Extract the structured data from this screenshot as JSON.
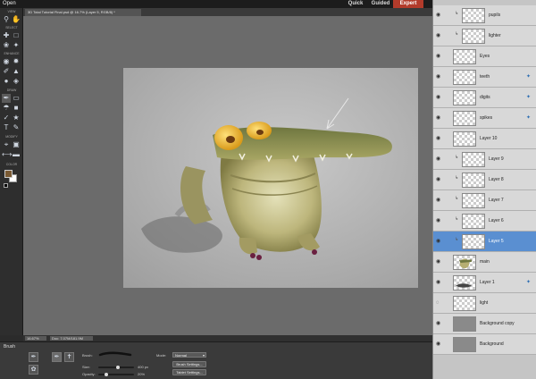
{
  "app": {
    "open_label": "Open",
    "tabs": {
      "quick": "Quick",
      "guided": "Guided",
      "expert": "Expert"
    },
    "accent_color": "#b23b2b"
  },
  "document": {
    "tab_title": "3D Total Tutorial Final.psd @ 16.7% (Layer 5, RGB/8) *",
    "zoom": "16.67%",
    "info": "Doc: 7.07M/181.9M"
  },
  "toolbox": {
    "sections": {
      "view": "VIEW",
      "select": "SELECT",
      "enhance": "ENHANCE",
      "draw": "DRAW",
      "modify": "MODIFY",
      "color": "COLOR"
    },
    "foreground_color": "#7a5a33",
    "background_color": "#ffffff"
  },
  "options": {
    "title": "Brush",
    "brush_label": "Brush:",
    "size_label": "Size:",
    "size_value": "400 px",
    "size_level": 0.55,
    "opacity_label": "Opacity:",
    "opacity_value": "20%",
    "opacity_level": 0.2,
    "mode_label": "Mode:",
    "mode_value": "Normal",
    "brush_settings": "Brush Settings...",
    "tablet_settings": "Tablet Settings..."
  },
  "layers": [
    {
      "name": "pupils",
      "thumb": "transparent",
      "visible": true,
      "fx": false,
      "linked": true,
      "indent": 1
    },
    {
      "name": "lighter",
      "thumb": "transparent",
      "visible": true,
      "fx": false,
      "linked": true,
      "indent": 1
    },
    {
      "name": "Eyes",
      "thumb": "transparent",
      "visible": true,
      "fx": false,
      "linked": false,
      "indent": 0
    },
    {
      "name": "teeth",
      "thumb": "transparent",
      "visible": true,
      "fx": true,
      "linked": false,
      "indent": 0
    },
    {
      "name": "digits",
      "thumb": "transparent",
      "visible": true,
      "fx": true,
      "linked": false,
      "indent": 0
    },
    {
      "name": "spikes",
      "thumb": "transparent",
      "visible": true,
      "fx": true,
      "linked": false,
      "indent": 0
    },
    {
      "name": "Layer 10",
      "thumb": "transparent",
      "visible": true,
      "fx": false,
      "linked": false,
      "indent": 0
    },
    {
      "name": "Layer 9",
      "thumb": "transparent",
      "visible": true,
      "fx": false,
      "linked": true,
      "indent": 1
    },
    {
      "name": "Layer 8",
      "thumb": "transparent",
      "visible": true,
      "fx": false,
      "linked": true,
      "indent": 1
    },
    {
      "name": "Layer 7",
      "thumb": "transparent",
      "visible": true,
      "fx": false,
      "linked": true,
      "indent": 1
    },
    {
      "name": "Layer 6",
      "thumb": "transparent",
      "visible": true,
      "fx": false,
      "linked": true,
      "indent": 1
    },
    {
      "name": "Layer 5",
      "thumb": "transparent",
      "visible": true,
      "fx": false,
      "linked": true,
      "indent": 1,
      "selected": true
    },
    {
      "name": "main",
      "thumb": "creature",
      "visible": true,
      "fx": false,
      "linked": false,
      "indent": 0
    },
    {
      "name": "Layer 1",
      "thumb": "shadow",
      "visible": true,
      "fx": true,
      "linked": false,
      "indent": 0
    },
    {
      "name": "light",
      "thumb": "transparent",
      "visible": false,
      "fx": false,
      "linked": false,
      "indent": 0
    },
    {
      "name": "Background copy",
      "thumb": "solid",
      "visible": true,
      "fx": false,
      "linked": false,
      "indent": 0
    },
    {
      "name": "Background",
      "thumb": "solid",
      "visible": true,
      "fx": false,
      "linked": false,
      "indent": 0
    }
  ]
}
